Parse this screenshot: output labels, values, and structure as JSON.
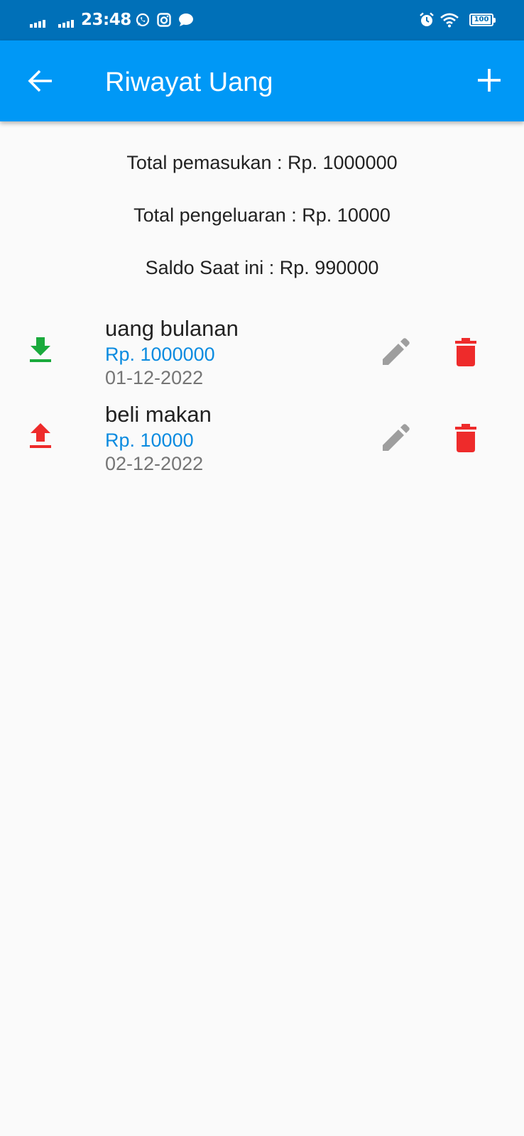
{
  "status_bar": {
    "time": "23:48",
    "battery": "100",
    "icons": [
      "signal-icon",
      "signal-icon",
      "whatsapp-icon",
      "instagram-icon",
      "chat-bubble-icon",
      "alarm-icon",
      "wifi-icon",
      "battery-icon"
    ]
  },
  "app_bar": {
    "title": "Riwayat Uang",
    "back_icon": "arrow-back-icon",
    "add_icon": "plus-icon",
    "background": "#0098f6"
  },
  "summary": {
    "income": "Total pemasukan : Rp. 1000000",
    "expense": "Total pengeluaran : Rp. 10000",
    "balance": "Saldo Saat ini : Rp. 990000"
  },
  "transactions": [
    {
      "type": "income",
      "icon": "download-icon",
      "icon_color": "#1aaa3c",
      "name": "uang bulanan",
      "amount": "Rp. 1000000",
      "date": "01-12-2022"
    },
    {
      "type": "expense",
      "icon": "upload-icon",
      "icon_color": "#ee2b2b",
      "name": "beli makan",
      "amount": "Rp. 10000",
      "date": "02-12-2022"
    }
  ],
  "colors": {
    "status_bar": "#0070b8",
    "amount_text": "#0a8be0",
    "edit_icon": "#9e9e9e",
    "delete_icon": "#ee2b2b"
  }
}
